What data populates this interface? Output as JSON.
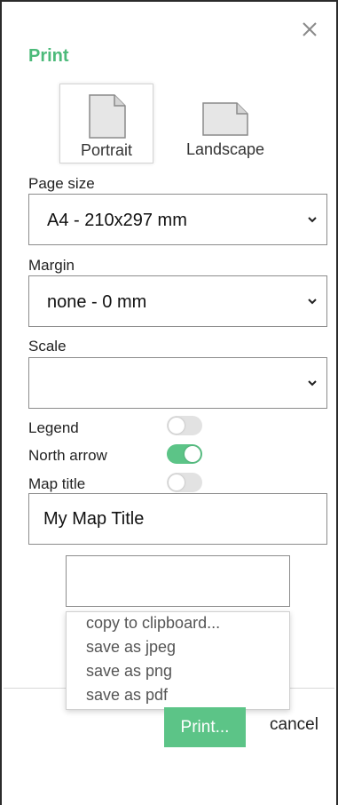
{
  "dialog": {
    "title": "Print",
    "close_icon": "close-icon",
    "accent_color": "#4cba7a"
  },
  "orientation": {
    "options": [
      {
        "label": "Portrait",
        "icon": "portrait-page-icon",
        "selected": true
      },
      {
        "label": "Landscape",
        "icon": "landscape-page-icon",
        "selected": false
      }
    ]
  },
  "page_size": {
    "label": "Page size",
    "value": "A4 - 210x297 mm"
  },
  "margin": {
    "label": "Margin",
    "value": "none - 0 mm"
  },
  "scale": {
    "label": "Scale",
    "value": ""
  },
  "toggles": [
    {
      "label": "Legend",
      "on": false
    },
    {
      "label": "North arrow",
      "on": true
    },
    {
      "label": "Map title",
      "on": false
    }
  ],
  "map_title_input": {
    "value": "My Map Title"
  },
  "export_menu": {
    "items": [
      "copy to clipboard...",
      "save as jpeg",
      "save as png",
      "save as pdf"
    ]
  },
  "actions": {
    "print_label": "Print...",
    "cancel_label": "cancel",
    "print_color": "#5cc487"
  }
}
